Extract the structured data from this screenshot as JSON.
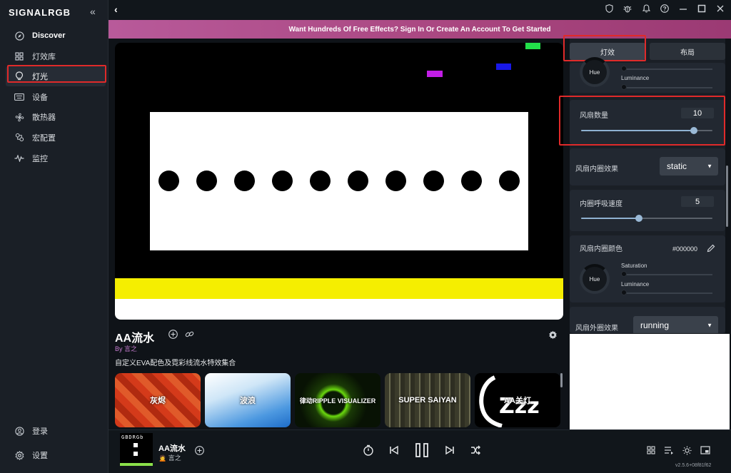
{
  "app": {
    "logo": "SIGNALRGB",
    "collapse_icon": "«",
    "back_icon": "‹",
    "version": "v2.5.6+08f81f62"
  },
  "sidebar": {
    "items": [
      {
        "label": "Discover",
        "icon": "compass-icon"
      },
      {
        "label": "灯效库",
        "icon": "grid-icon"
      },
      {
        "label": "灯光",
        "icon": "bulb-icon"
      },
      {
        "label": "设备",
        "icon": "keyboard-icon"
      },
      {
        "label": "散热器",
        "icon": "fan-icon"
      },
      {
        "label": "宏配置",
        "icon": "macro-icon"
      },
      {
        "label": "监控",
        "icon": "pulse-icon"
      }
    ],
    "bottom": [
      {
        "label": "登录",
        "icon": "user-icon"
      },
      {
        "label": "设置",
        "icon": "gear-icon"
      }
    ]
  },
  "banner": {
    "text": "Want Hundreds Of Free Effects? Sign In Or Create An Account To Get Started"
  },
  "effect": {
    "name": "AA流水",
    "by_prefix": "By",
    "author": "言之",
    "description": "自定义EVA配色及霓彩线流水特效集合"
  },
  "thumbnails": [
    {
      "label": "灰烬"
    },
    {
      "label": "波浪"
    },
    {
      "label": "律动RIPPLE VISUALIZER"
    },
    {
      "label": "SUPER SAIYAN"
    },
    {
      "label": "AA关灯"
    }
  ],
  "right_panel": {
    "tabs": [
      {
        "label": "灯效"
      },
      {
        "label": "布局"
      }
    ],
    "top_knob": {
      "label": "Hue",
      "luminance_label": "Luminance"
    },
    "fan_count": {
      "label": "风扇数量",
      "value": "10",
      "level": 0.86
    },
    "inner_effect": {
      "label": "风扇内圈效果",
      "value": "static"
    },
    "breath_speed": {
      "label": "内圈呼吸速度",
      "value": "5",
      "level": 0.44
    },
    "inner_color": {
      "label": "风扇内圈颜色",
      "hex": "#000000",
      "knob_label": "Hue",
      "saturation_label": "Saturation",
      "luminance_label": "Luminance"
    },
    "outer_effect": {
      "label": "风扇外圈效果",
      "value": "running"
    }
  },
  "player": {
    "thumb_label": "GBDRGb",
    "title": "AA流水",
    "author": "言之",
    "author_prefix": "🙍"
  },
  "colors": {
    "banner": "#a8457e",
    "accent_slider": "#9ab9d6",
    "highlight": "#e02a2a",
    "preview_yellow": "#f5ee00"
  }
}
